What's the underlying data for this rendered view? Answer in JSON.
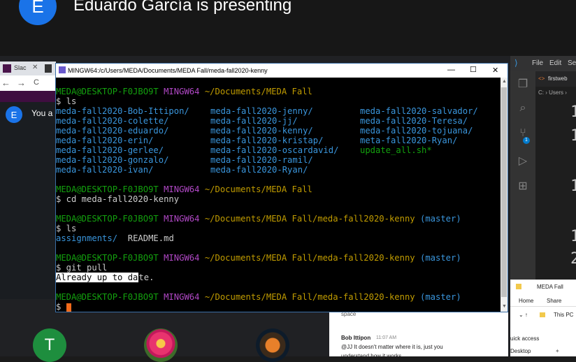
{
  "banner": {
    "avatar_letter": "E",
    "presenter_text": "Eduardo García is presenting"
  },
  "browser": {
    "tab_label": "Slac",
    "nav_back": "←",
    "nav_forward": "→",
    "nav_reload": "C"
  },
  "slack": {
    "avatar_letter": "E",
    "you_text": "You a"
  },
  "terminal": {
    "title": "MINGW64:/c/Users/MEDA/Documents/MEDA Fall/meda-fall2020-kenny",
    "min": "—",
    "max": "☐",
    "close": "✕",
    "host": "MEDA@DESKTOP-F0JBO9T",
    "shell": "MINGW64",
    "path_root": "~/Documents/MEDA Fall",
    "path_repo": "~/Documents/MEDA Fall/meda-fall2020-kenny",
    "branch": "(master)",
    "cmd_ls": "$ ls",
    "ls_col1": [
      "meda-fall2020-Bob-Ittipon/",
      "meda-fall2020-colette/",
      "meda-fall2020-eduardo/",
      "meda-fall2020-erin/",
      "meda-fall2020-gerlee/",
      "meda-fall2020-gonzalo/",
      "meda-fall2020-ivan/"
    ],
    "ls_col2": [
      "meda-fall2020-jenny/",
      "meda-fall2020-jj/",
      "meda-fall2020-kenny/",
      "meda-fall2020-kristap/",
      "meda-fall2020-oscardavid/",
      "meda-fall2020-ramil/",
      "meda-fall2020-Ryan/"
    ],
    "ls_col3": [
      "meda-fall2020-salvador/",
      "meda-fall2020-Teresa/",
      "meda-fall2020-tojuana/",
      "meta-fall2020-Ryan/",
      "update_all.sh*"
    ],
    "cmd_cd": "$ cd meda-fall2020-kenny",
    "ls2_dir": "assignments/",
    "ls2_file": "README.md",
    "cmd_pull": "$ git pull",
    "pull_selected": "Already up to da",
    "pull_cursor": "t",
    "pull_rest": "e.",
    "prompt": "$ "
  },
  "vscode": {
    "menu_file": "File",
    "menu_edit": "Edit",
    "menu_sel": "Se",
    "tab": "firstweb",
    "breadcrumb": "C: › Users ›",
    "line_numbers": [
      "1",
      "1",
      "1",
      "1",
      "2",
      "2"
    ]
  },
  "explorer": {
    "title": "MEDA Fall",
    "home": "Home",
    "share": "Share",
    "this_pc": "This PC",
    "quick_access": "uick access",
    "desktop": "Desktop"
  },
  "chat": {
    "partial": "space",
    "name": "Bob Ittipon",
    "time": "11:07 AM",
    "message": "@JJ It doesn't matter where it is, just you",
    "message2": "understand how it works"
  },
  "participants": {
    "t_letter": "T"
  }
}
